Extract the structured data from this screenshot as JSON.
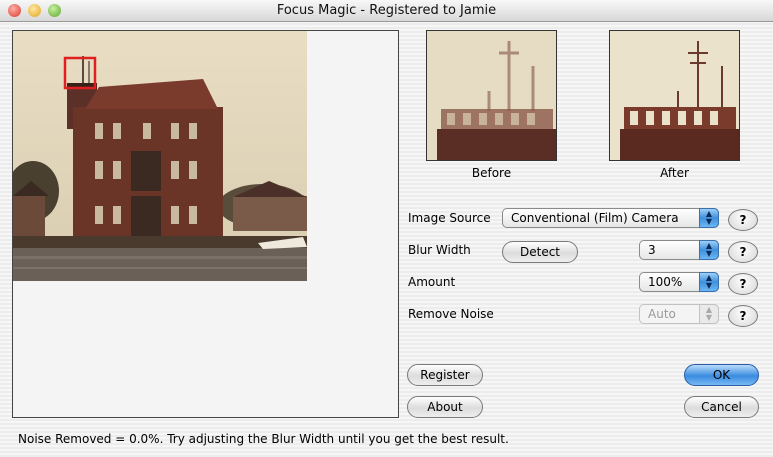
{
  "window": {
    "title": "Focus Magic - Registered to Jamie"
  },
  "thumbnails": {
    "before_label": "Before",
    "after_label": "After"
  },
  "settings": {
    "image_source": {
      "label": "Image Source",
      "value": "Conventional (Film) Camera"
    },
    "blur_width": {
      "label": "Blur Width",
      "detect_label": "Detect",
      "value": "3"
    },
    "amount": {
      "label": "Amount",
      "value": "100%"
    },
    "remove_noise": {
      "label": "Remove Noise",
      "value": "Auto"
    },
    "help_label": "?"
  },
  "buttons": {
    "register": "Register",
    "about": "About",
    "ok": "OK",
    "cancel": "Cancel"
  },
  "status": "Noise Removed = 0.0%. Try adjusting the Blur Width until you get the best result.",
  "icons": [
    "close-icon",
    "minimize-icon",
    "zoom-icon",
    "up-down-arrows-icon"
  ],
  "colors": {
    "accent": "#3b8be0",
    "selection_box": "#e02020"
  }
}
